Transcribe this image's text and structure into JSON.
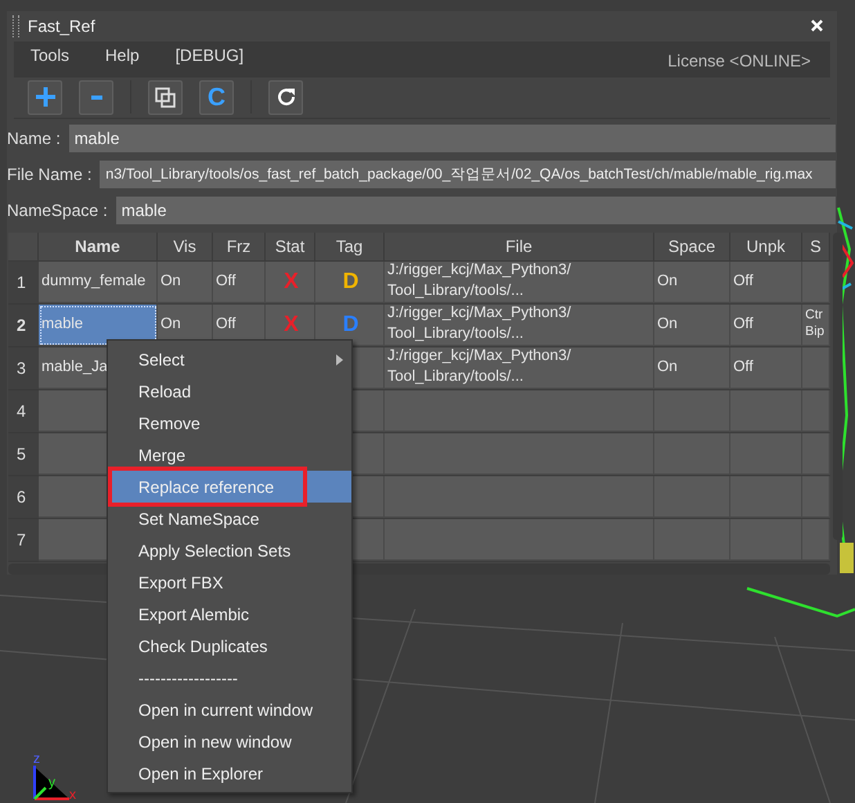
{
  "window": {
    "title": "Fast_Ref"
  },
  "menu": [
    "Tools",
    "Help",
    "[DEBUG]"
  ],
  "license": "License <ONLINE>",
  "toolbar": [
    {
      "kind": "plus"
    },
    {
      "kind": "minus"
    },
    {
      "kind": "sep"
    },
    {
      "kind": "copy"
    },
    {
      "kind": "letter",
      "label": "C"
    },
    {
      "kind": "sep"
    },
    {
      "kind": "refresh"
    }
  ],
  "fields": [
    {
      "label": "Name :",
      "value": "mable"
    },
    {
      "label": "File Name :",
      "value": "n3/Tool_Library/tools/os_fast_ref_batch_package/00_작업문서/02_QA/os_batchTest/ch/mable/mable_rig.max"
    },
    {
      "label": "NameSpace :",
      "value": "mable"
    }
  ],
  "table": {
    "columns": [
      "Name",
      "Vis",
      "Frz",
      "Stat",
      "Tag",
      "File",
      "Space",
      "Unpk",
      "S"
    ],
    "rows": [
      {
        "number": "1",
        "selected": false,
        "cells": [
          "dummy_female",
          "On",
          "Off",
          "X",
          "D",
          "J:/rigger_kcj/Max_Python3/\nTool_Library/tools/...",
          "On",
          "Off",
          ""
        ],
        "color": "#f0b400"
      },
      {
        "number": "2",
        "selected": true,
        "cells": [
          "mable",
          "On",
          "Off",
          "X",
          "D",
          "J:/rigger_kcj/Max_Python3/\nTool_Library/tools/...",
          "On",
          "Off",
          "Ctr\nBip"
        ],
        "color": "#2a7fff"
      },
      {
        "number": "3",
        "selected": false,
        "cells": [
          "mable_Ja",
          "",
          "",
          "",
          "",
          "J:/rigger_kcj/Max_Python3/\nTool_Library/tools/...",
          "On",
          "Off",
          ""
        ]
      },
      {
        "number": "4",
        "selected": false,
        "cells": [
          "",
          "",
          "",
          "",
          "",
          "",
          "",
          "",
          ""
        ]
      },
      {
        "number": "5",
        "selected": false,
        "cells": [
          "",
          "",
          "",
          "",
          "",
          "",
          "",
          "",
          ""
        ]
      },
      {
        "number": "6",
        "selected": false,
        "cells": [
          "",
          "",
          "",
          "",
          "",
          "",
          "",
          "",
          ""
        ]
      },
      {
        "number": "7",
        "selected": false,
        "cells": [
          "",
          "",
          "",
          "",
          "",
          "",
          "",
          "",
          ""
        ]
      }
    ]
  },
  "context_menu": [
    {
      "label": "Select",
      "selected": false,
      "submenu": true
    },
    {
      "label": "Reload",
      "selected": false,
      "submenu": false
    },
    {
      "label": "Remove",
      "selected": false,
      "submenu": false
    },
    {
      "label": "Merge",
      "selected": false,
      "submenu": false
    },
    {
      "label": "Replace reference",
      "selected": true,
      "submenu": false
    },
    {
      "label": "Set NameSpace",
      "selected": false,
      "submenu": false
    },
    {
      "label": "Apply Selection Sets",
      "selected": false,
      "submenu": false
    },
    {
      "label": "Export FBX",
      "selected": false,
      "submenu": false
    },
    {
      "label": "Export Alembic",
      "selected": false,
      "submenu": false
    },
    {
      "label": "Check Duplicates",
      "selected": false,
      "submenu": false
    },
    {
      "label": "------------------",
      "selected": false,
      "submenu": false
    },
    {
      "label": "Open in current window",
      "selected": false,
      "submenu": false
    },
    {
      "label": "Open in new window",
      "selected": false,
      "submenu": false
    },
    {
      "label": "Open in Explorer",
      "selected": false,
      "submenu": false
    }
  ],
  "axis_labels": [
    "z",
    "y",
    "x"
  ]
}
